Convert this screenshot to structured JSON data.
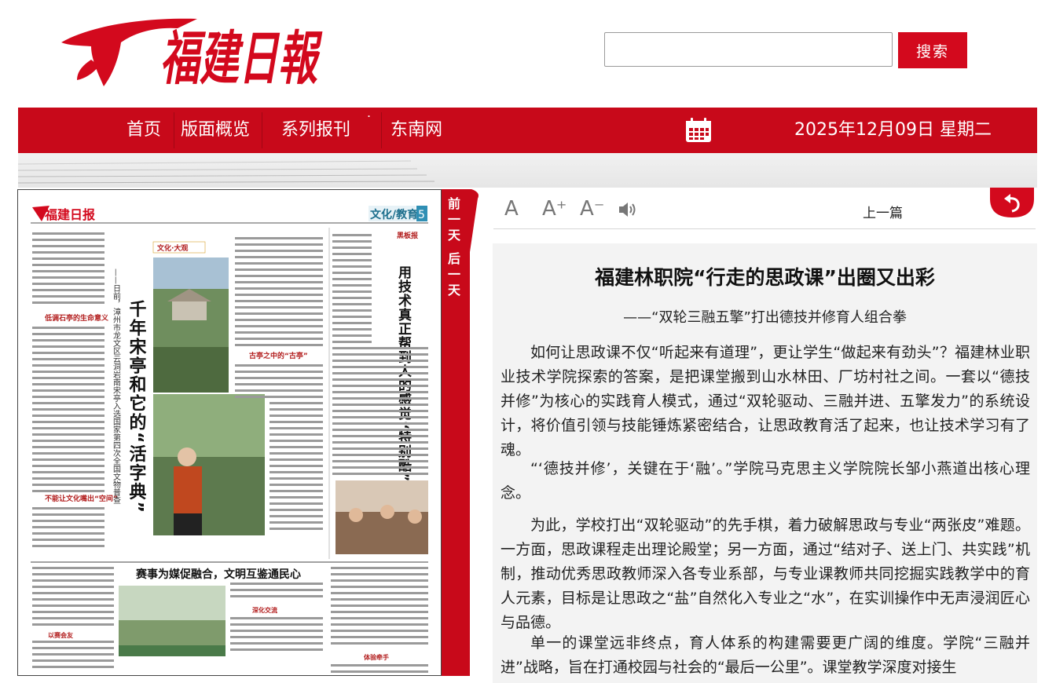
{
  "header": {
    "logo_text": "福建日報",
    "search_placeholder": "",
    "search_button": "搜索"
  },
  "nav": {
    "items": [
      "首页",
      "版面概览",
      "系列报刊",
      "东南网"
    ],
    "dropdown_caret": "˙",
    "date": "2025年12月09日 星期二"
  },
  "day_tab": {
    "prev": [
      "前",
      "一",
      "天"
    ],
    "next": [
      "后",
      "一",
      "天"
    ]
  },
  "newspaper": {
    "masthead": "福建日报",
    "section": "文化/教育",
    "page_no": "5",
    "column_label": "文化·大观",
    "headline_main": "千年宋亭和它的“活字典”",
    "headline_sub": "——日前，漳州市龙文区云洞岩南宋亭入选国家第四次全国文物普查",
    "right_column_tag": "黑板报",
    "right_headline": "用技术真正帮到人的感觉“特别酷”",
    "section_title_1": "低调石亭的生命意义",
    "section_title_2": "古亭之中的“古亭”",
    "section_title_3": "不能让文化嘴出“空间”",
    "bottom_headline": "赛事为媒促融合，文明互鉴通民心",
    "bottom_sub_1": "深化交流",
    "bottom_sub_2": "以赛会友",
    "bottom_sub_3": "体验牵手"
  },
  "toolbar": {
    "font_normal": "A",
    "font_larger": "A⁺",
    "font_smaller": "A⁻",
    "prev_article": "上一篇"
  },
  "article": {
    "title": "福建林职院“行走的思政课”出圈又出彩",
    "subtitle": "——“双轮三融五擎”打出德技并修育人组合拳",
    "paragraphs": [
      "如何让思政课不仅“听起来有道理”，更让学生“做起来有劲头”？福建林业职业技术学院探索的答案，是把课堂搬到山水林田、厂坊村社之间。一套以“德技并修”为核心的实践育人模式，通过“双轮驱动、三融并进、五擎发力”的系统设计，将价值引领与技能锤炼紧密结合，让思政教育活了起来，也让技术学习有了魂。",
      "“‘德技并修’，关键在于‘融’。”学院马克思主义学院院长邹小燕道出核心理念。",
      "为此，学校打出“双轮驱动”的先手棋，着力破解思政与专业“两张皮”难题。一方面，思政课程走出理论殿堂；另一方面，通过“结对子、送上门、共实践”机制，推动优秀思政教师深入各专业系部，与专业课教师共同挖掘实践教学中的育人元素，目标是让思政之“盐”自然化入专业之“水”，在实训操作中无声浸润匠心与品德。",
      "单一的课堂远非终点，育人体系的构建需要更广阔的维度。学院“三融并进”战略，旨在打通校园与社会的“最后一公里”。课堂教学深度对接生"
    ]
  },
  "colors": {
    "brand_red": "#c8091a",
    "search_red": "#d3091d",
    "article_bg": "#f3f3f3"
  }
}
